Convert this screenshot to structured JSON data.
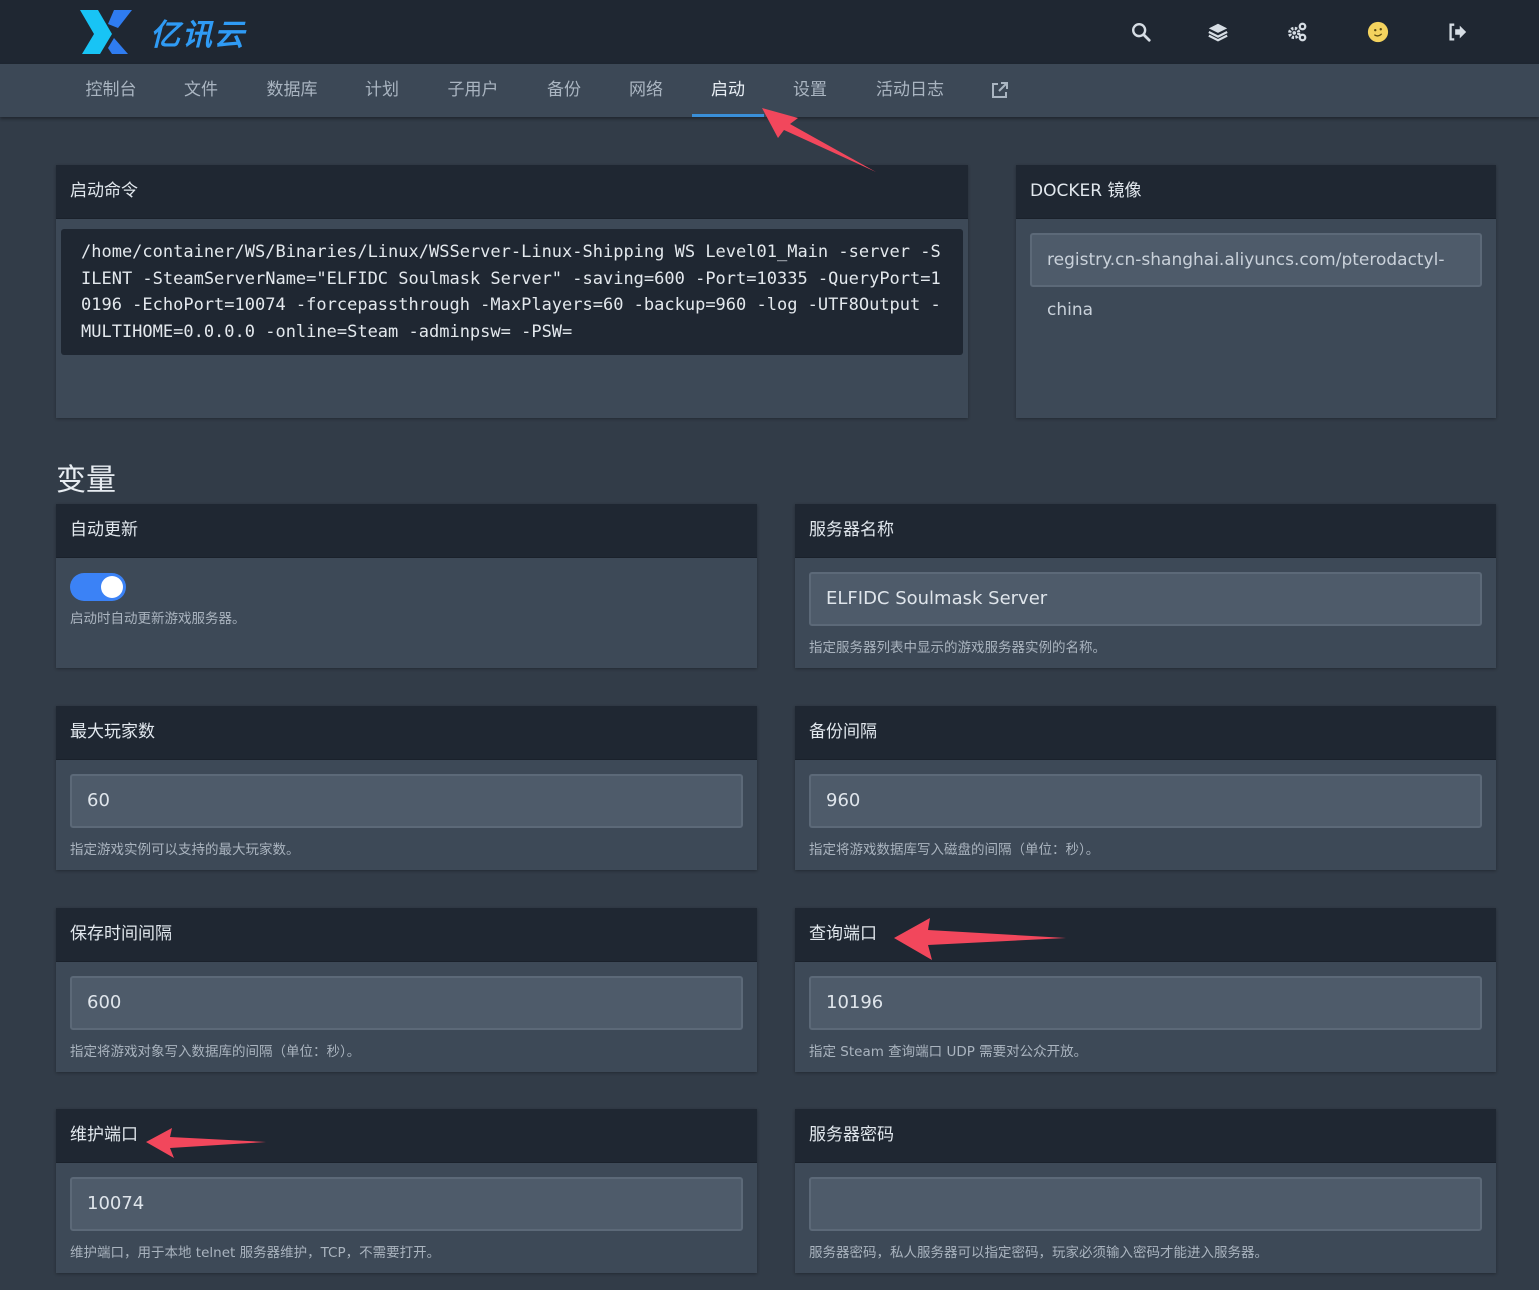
{
  "header": {
    "brand": "亿讯云",
    "icons": [
      "search-icon",
      "layers-icon",
      "settings-icon",
      "avatar-icon",
      "logout-icon"
    ]
  },
  "nav": {
    "items": [
      "控制台",
      "文件",
      "数据库",
      "计划",
      "子用户",
      "备份",
      "网络",
      "启动",
      "设置",
      "活动日志"
    ],
    "active": "启动"
  },
  "startup": {
    "title": "启动命令",
    "command": "/home/container/WS/Binaries/Linux/WSServer-Linux-Shipping WS Level01_Main -server -SILENT -SteamServerName=\"ELFIDC Soulmask Server\" -saving=600 -Port=10335 -QueryPort=10196 -EchoPort=10074 -forcepassthrough -MaxPlayers=60 -backup=960 -log -UTF8Output -MULTIHOME=0.0.0.0 -online=Steam -adminpsw= -PSW="
  },
  "docker": {
    "title": "DOCKER 镜像",
    "value": "registry.cn-shanghai.aliyuncs.com/pterodactyl-china"
  },
  "variables_title": "变量",
  "variables": {
    "auto_update": {
      "title": "自动更新",
      "help": "启动时自动更新游戏服务器。",
      "enabled": true
    },
    "server_name": {
      "title": "服务器名称",
      "value": "ELFIDC Soulmask Server",
      "help": "指定服务器列表中显示的游戏服务器实例的名称。"
    },
    "max_players": {
      "title": "最大玩家数",
      "value": "60",
      "help": "指定游戏实例可以支持的最大玩家数。"
    },
    "backup_interval": {
      "title": "备份间隔",
      "value": "960",
      "help": "指定将游戏数据库写入磁盘的间隔（单位：秒）。"
    },
    "save_interval": {
      "title": "保存时间间隔",
      "value": "600",
      "help": "指定将游戏对象写入数据库的间隔（单位：秒）。"
    },
    "query_port": {
      "title": "查询端口",
      "value": "10196",
      "help": "指定 Steam 查询端口 UDP 需要对公众开放。"
    },
    "echo_port": {
      "title": "维护端口",
      "value": "10074",
      "help": "维护端口，用于本地 telnet 服务器维护，TCP，不需要打开。"
    },
    "server_password": {
      "title": "服务器密码",
      "value": "",
      "help": "服务器密码，私人服务器可以指定密码，玩家必须输入密码才能进入服务器。"
    }
  },
  "colors": {
    "accent": "#3b82f6",
    "annotation_arrow": "#f2475c",
    "brand": "#2f9bf5"
  }
}
